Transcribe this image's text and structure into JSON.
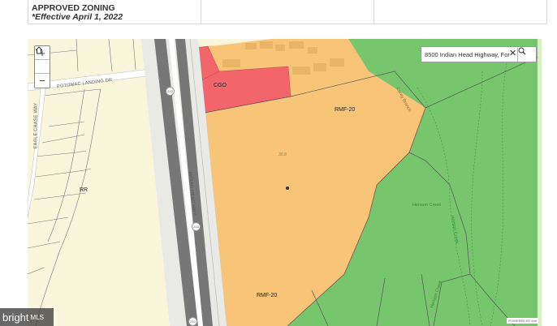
{
  "header": {
    "title": "APPROVED ZONING",
    "subtitle": "*Effective April 1, 2022"
  },
  "search": {
    "value": "8500 Indian Head Highway, Fort"
  },
  "zones": {
    "cgo": "CGO",
    "rmf_top": "RMF-20",
    "rmf_bottom": "RMF-20",
    "rr": "RR",
    "acreage": "30.8"
  },
  "roads": {
    "potomac_landing": "POTOMAC LANDING DR",
    "eagle_chase": "EAGLE CHASE WAY",
    "indian_head": "INDIAN HEAD HWY",
    "route_210": "210"
  },
  "water": {
    "carey_branch": "Carey Branch",
    "henson_creek_1": "Henson Creek",
    "henson_creek_2": "Henson Creek",
    "henson_creek_3": "Henson Creek"
  },
  "attribution": "POWERED BY esri",
  "watermark": {
    "brand": "bright",
    "suffix": "MLS"
  },
  "colors": {
    "rmf": "#f8c477",
    "cgo": "#f2666b",
    "rr": "#f9f6dc",
    "parkland": "#77c66e",
    "highway": "#777777"
  }
}
